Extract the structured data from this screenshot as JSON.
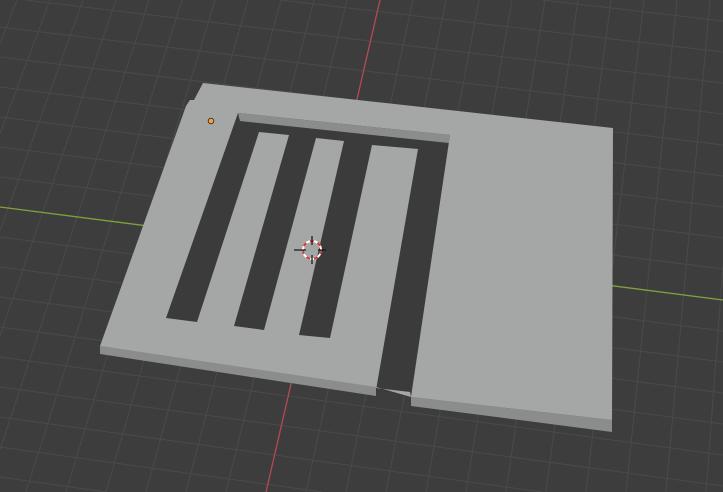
{
  "viewport": {
    "colors": {
      "background": "#3d3d3d",
      "grid": "#4a4a4a",
      "x_axis": "#b34a52",
      "y_axis": "#7fa33a",
      "mesh_top": "#a5a7a7",
      "mesh_side": "#8b8d8d",
      "hole": "#3b3b3b",
      "origin": "#f2a33a"
    }
  }
}
